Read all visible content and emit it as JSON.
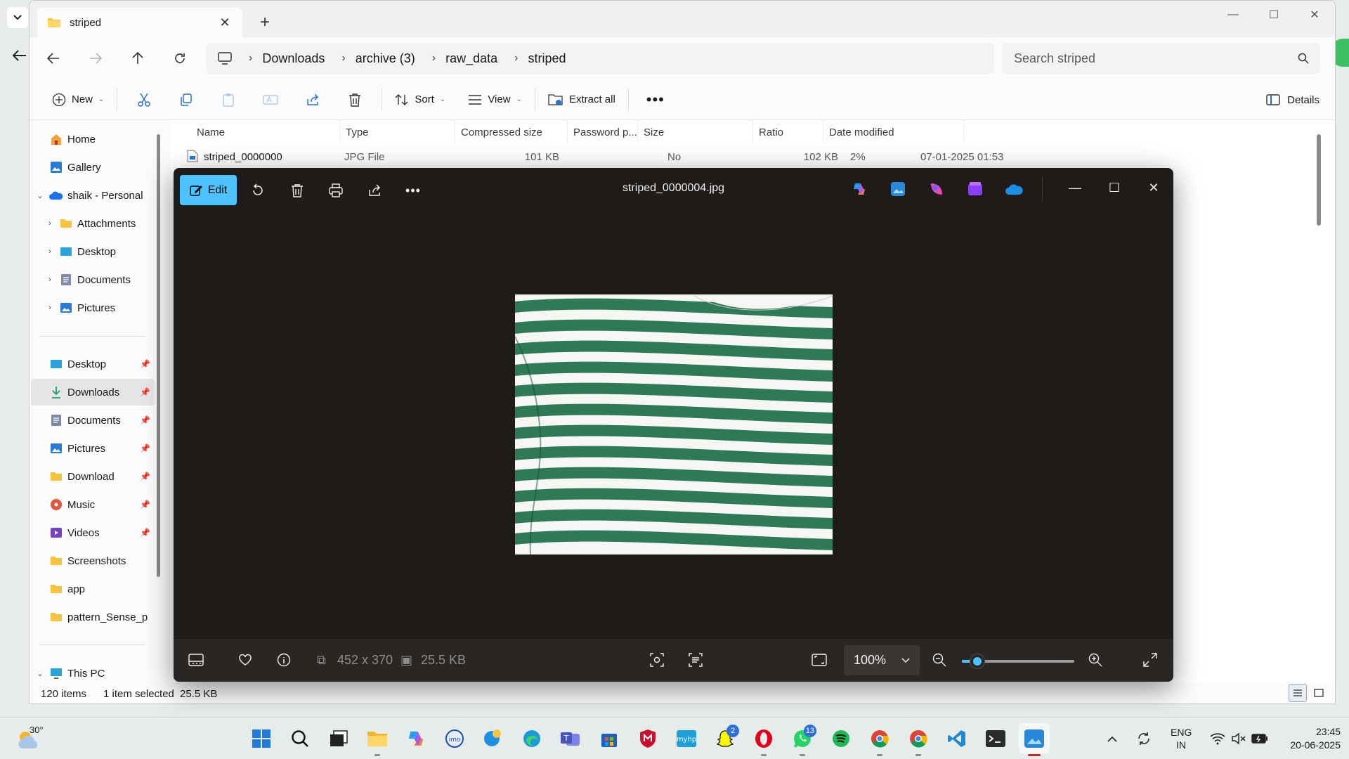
{
  "explorer": {
    "tab_title": "striped",
    "breadcrumb": [
      "Downloads",
      "archive (3)",
      "raw_data",
      "striped"
    ],
    "search_placeholder": "Search striped",
    "commands": {
      "new_label": "New",
      "sort_label": "Sort",
      "view_label": "View",
      "extract_all_label": "Extract all",
      "details_label": "Details"
    },
    "nav": {
      "home": "Home",
      "gallery": "Gallery",
      "onedrive": "shaik - Personal",
      "attachments": "Attachments",
      "desktop_od": "Desktop",
      "documents_od": "Documents",
      "pictures_od": "Pictures",
      "desktop": "Desktop",
      "downloads": "Downloads",
      "documents": "Documents",
      "pictures": "Pictures",
      "download": "Download",
      "music": "Music",
      "videos": "Videos",
      "screenshots": "Screenshots",
      "app": "app",
      "pattern": "pattern_Sense_p",
      "this_pc": "This PC"
    },
    "columns": [
      "Name",
      "Type",
      "Compressed size",
      "Password p...",
      "Size",
      "Ratio",
      "Date modified"
    ],
    "first_row": {
      "name": "striped_0000000",
      "type": "JPG File",
      "compressed": "101 KB",
      "password": "No",
      "size": "102 KB",
      "ratio": "2%",
      "date": "07-01-2025 01:53"
    },
    "status": {
      "items": "120 items",
      "selected": "1 item selected",
      "sel_size": "25.5 KB"
    }
  },
  "photos": {
    "edit_label": "Edit",
    "title": "striped_0000004.jpg",
    "dimensions": "452 x 370",
    "file_size": "25.5 KB",
    "zoom": "100%",
    "zoom_slider_fraction": 0.14
  },
  "taskbar": {
    "temperature": "30°",
    "lang_line1": "ENG",
    "lang_line2": "IN",
    "time": "23:45",
    "date": "20-06-2025",
    "badges": {
      "snap": "2",
      "whatsapp": "13"
    }
  },
  "colors": {
    "accent": "#4cc2ff",
    "stripe_green": "#2e7a56",
    "viewer_bg": "#1f1b19"
  }
}
